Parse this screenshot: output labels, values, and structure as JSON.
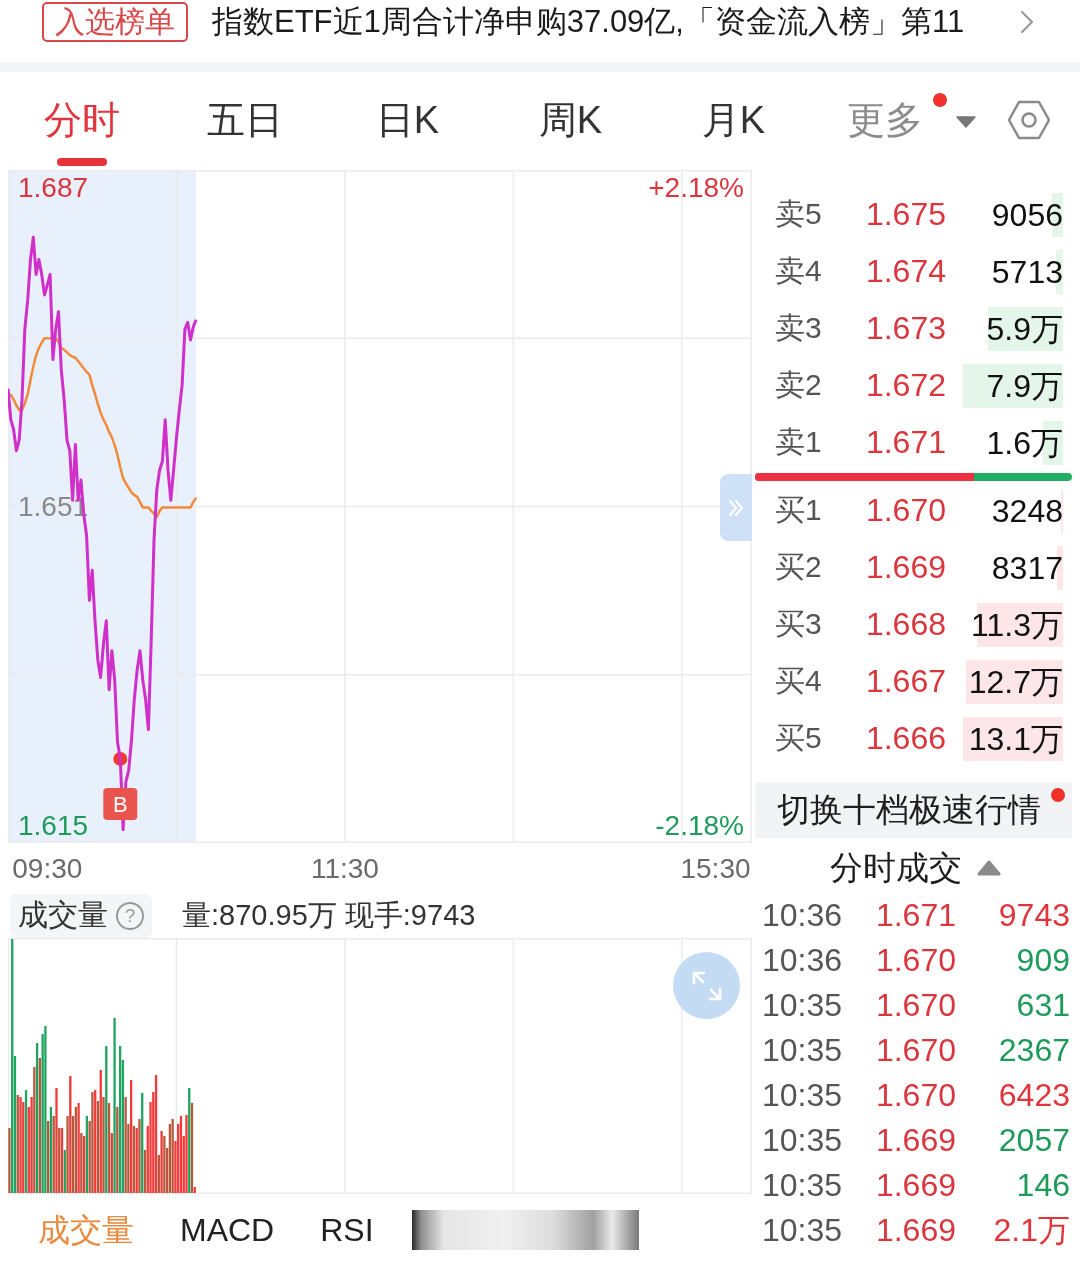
{
  "banner": {
    "badge": "入选榜单",
    "text": "指数ETF近1周合计净申购37.09亿,「资金流入榜」第11"
  },
  "chart_tabs": [
    {
      "label": "分时",
      "kind": "tab",
      "selected": true
    },
    {
      "label": "五日",
      "kind": "tab",
      "selected": false
    },
    {
      "label": "日K",
      "kind": "tab",
      "selected": false
    },
    {
      "label": "周K",
      "kind": "tab",
      "selected": false
    },
    {
      "label": "月K",
      "kind": "tab",
      "selected": false
    },
    {
      "label": "更多",
      "kind": "menu",
      "selected": false,
      "dot": true
    }
  ],
  "intraday_chart": {
    "percent_labels": [
      "+2.18%",
      "-2.18%"
    ],
    "chart_data": {
      "type": "line",
      "categories": [
        null,
        null,
        null,
        null,
        null,
        null,
        null,
        null,
        null,
        null,
        null,
        null,
        null,
        null,
        "09:30",
        null,
        null,
        null,
        null,
        null,
        null,
        null,
        null,
        null,
        null,
        null,
        null,
        null,
        null,
        null,
        null,
        null,
        null,
        null,
        null,
        null,
        null,
        null,
        null,
        null,
        null,
        null,
        null,
        null,
        null,
        null,
        null,
        null,
        null,
        null,
        null,
        null,
        null,
        null,
        null,
        null,
        null,
        null,
        null,
        null,
        null,
        null,
        null,
        null,
        null,
        null,
        null,
        null,
        null,
        null,
        null,
        null,
        null,
        null,
        null,
        null,
        null,
        null,
        null,
        null,
        null,
        null,
        null,
        null,
        null,
        null,
        null,
        null,
        null,
        null,
        null,
        null,
        null,
        null,
        null,
        null,
        null,
        null,
        null,
        null,
        null,
        null,
        null,
        null,
        null,
        null,
        null,
        null,
        null,
        null,
        null,
        null,
        null,
        null,
        null,
        null,
        null,
        null,
        null,
        null,
        "11:30",
        null,
        null,
        null,
        null,
        null,
        null,
        null,
        null,
        null,
        null,
        null,
        null,
        null,
        null,
        null,
        null,
        null,
        null,
        null,
        null,
        null,
        null,
        null,
        null,
        null,
        null,
        null,
        null,
        null,
        null,
        null,
        null,
        null,
        null,
        null,
        null,
        null,
        null,
        null,
        null,
        null,
        null,
        null,
        null,
        null,
        null,
        null,
        null,
        null,
        null,
        null,
        null,
        null,
        null,
        null,
        null,
        null,
        null,
        null,
        null,
        null,
        null,
        null,
        null,
        null,
        null,
        null,
        null,
        null,
        null,
        null,
        null,
        null,
        null,
        null,
        null,
        null,
        null,
        null,
        null,
        null,
        null,
        null,
        null,
        null,
        null,
        null,
        null,
        null,
        null,
        null,
        null,
        null,
        null,
        null,
        null,
        null,
        null,
        null,
        null,
        null,
        null,
        null,
        null,
        null,
        null,
        null,
        null,
        null,
        null,
        null,
        null,
        null,
        null,
        null,
        null,
        null,
        null,
        null,
        null,
        null,
        null,
        null,
        null,
        null,
        null,
        null,
        null,
        null,
        null,
        null,
        "15:30",
        null,
        null,
        null,
        null,
        null,
        null,
        null,
        null,
        null,
        null,
        null,
        null,
        null
      ],
      "series": [
        {
          "color": "#d02fca",
          "values": [
            1.6643,
            1.6608,
            1.6597,
            1.6573,
            1.6585,
            1.663,
            1.671,
            1.6743,
            1.6789,
            1.6814,
            1.6772,
            1.6789,
            1.6772,
            1.6749,
            1.676,
            1.6772,
            1.6676,
            1.671,
            1.673,
            1.6664,
            1.663,
            1.6585,
            1.6573,
            1.6517,
            1.658,
            1.6517,
            1.654,
            1.6501,
            1.6477,
            1.6404,
            1.6438,
            1.6381,
            1.6337,
            1.6317,
            1.6355,
            1.6381,
            1.6303,
            1.6347,
            1.6314,
            1.6244,
            1.6225,
            1.6145,
            1.6199,
            1.6212,
            1.6246,
            1.6292,
            1.6325,
            1.6347,
            1.6314,
            1.6292,
            1.6258,
            1.6359,
            1.6472,
            1.6529,
            1.6551,
            1.6561,
            1.6608,
            1.6551,
            1.6517,
            1.6551,
            1.6588,
            1.6619,
            1.6647,
            1.671,
            1.6718,
            1.6698,
            1.6713,
            1.6721,
            null,
            null,
            null,
            null,
            null,
            null,
            null,
            null,
            null,
            null,
            null,
            null,
            null,
            null,
            null,
            null,
            null,
            null,
            null,
            null,
            null,
            null,
            null,
            null,
            null,
            null,
            null,
            null,
            null,
            null,
            null,
            null,
            null,
            null,
            null,
            null,
            null,
            null,
            null,
            null,
            null,
            null,
            null,
            null,
            null,
            null,
            null,
            null,
            null,
            null,
            null,
            null,
            null,
            null,
            null,
            null,
            null,
            null,
            null,
            null,
            null,
            null,
            null,
            null,
            null,
            null,
            null,
            null,
            null,
            null,
            null,
            null,
            null,
            null,
            null,
            null,
            null,
            null,
            null,
            null,
            null,
            null,
            null,
            null,
            null,
            null,
            null,
            null,
            null,
            null,
            null,
            null,
            null,
            null,
            null,
            null,
            null,
            null,
            null,
            null,
            null,
            null,
            null,
            null,
            null,
            null,
            null,
            null,
            null,
            null,
            null,
            null,
            null,
            null,
            null,
            null,
            null,
            null,
            null,
            null,
            null,
            null,
            null,
            null,
            null,
            null,
            null,
            null,
            null,
            null,
            null,
            null,
            null,
            null,
            null,
            null,
            null,
            null,
            null,
            null,
            null,
            null,
            null,
            null,
            null,
            null,
            null,
            null,
            null,
            null,
            null,
            null,
            null,
            null,
            null,
            null,
            null,
            null,
            null,
            null,
            null,
            null,
            null,
            null,
            null,
            null,
            null,
            null,
            null,
            null,
            null,
            null,
            null,
            null,
            null,
            null,
            null,
            null,
            null,
            null,
            null,
            null,
            null,
            null,
            null,
            null,
            null,
            null,
            null,
            null,
            null,
            null,
            null,
            null,
            null,
            null,
            null,
            null
          ]
        },
        {
          "color": "#f08a3c",
          "values": [
            1.6636,
            1.6636,
            1.6631,
            1.6624,
            1.6619,
            1.6619,
            1.6626,
            1.6637,
            1.6653,
            1.6668,
            1.6681,
            1.6689,
            1.6695,
            1.67,
            1.67,
            1.67,
            1.67,
            1.67,
            1.6696,
            1.6689,
            1.6687,
            1.6684,
            1.6681,
            1.6679,
            1.6678,
            1.6674,
            1.667,
            1.6666,
            1.6662,
            1.6659,
            1.6647,
            1.6637,
            1.6626,
            1.6616,
            1.6608,
            1.6602,
            1.6594,
            1.6588,
            1.6579,
            1.6568,
            1.6554,
            1.6542,
            1.6536,
            1.6531,
            1.6526,
            1.6523,
            1.6521,
            1.6515,
            1.6509,
            1.6509,
            1.6509,
            1.6505,
            1.6502,
            1.6498,
            1.6505,
            1.6509,
            1.6509,
            1.6509,
            1.6509,
            1.6509,
            1.6509,
            1.6509,
            1.6509,
            1.6509,
            1.6509,
            1.6509,
            1.6515,
            1.652,
            null,
            null,
            null,
            null,
            null,
            null,
            null,
            null,
            null,
            null,
            null,
            null,
            null,
            null,
            null,
            null,
            null,
            null,
            null,
            null,
            null,
            null,
            null,
            null,
            null,
            null,
            null,
            null,
            null,
            null,
            null,
            null,
            null,
            null,
            null,
            null,
            null,
            null,
            null,
            null,
            null,
            null,
            null,
            null,
            null,
            null,
            null,
            null,
            null,
            null,
            null,
            null,
            null,
            null,
            null,
            null,
            null,
            null,
            null,
            null,
            null,
            null,
            null,
            null,
            null,
            null,
            null,
            null,
            null,
            null,
            null,
            null,
            null,
            null,
            null,
            null,
            null,
            null,
            null,
            null,
            null,
            null,
            null,
            null,
            null,
            null,
            null,
            null,
            null,
            null,
            null,
            null,
            null,
            null,
            null,
            null,
            null,
            null,
            null,
            null,
            null,
            null,
            null,
            null,
            null,
            null,
            null,
            null,
            null,
            null,
            null,
            null,
            null,
            null,
            null,
            null,
            null,
            null,
            null,
            null,
            null,
            null,
            null,
            null,
            null,
            null,
            null,
            null,
            null,
            null,
            null,
            null,
            null,
            null,
            null,
            null,
            null,
            null,
            null,
            null,
            null,
            null,
            null,
            null,
            null,
            null,
            null,
            null,
            null,
            null,
            null,
            null,
            null,
            null,
            null,
            null,
            null,
            null,
            null,
            null,
            null,
            null,
            null,
            null,
            null,
            null,
            null,
            null,
            null,
            null,
            null,
            null,
            null,
            null,
            null,
            null,
            null,
            null,
            null,
            null,
            null,
            null,
            null,
            null,
            null,
            null,
            null,
            null,
            null,
            null,
            null,
            null,
            null,
            null,
            null,
            null,
            null,
            null
          ]
        }
      ],
      "ylim": [
        1.613,
        1.689
      ],
      "yticks": [
        {
          "value": 1.615,
          "label": "1.615"
        },
        {
          "value": 1.651,
          "label": "1.651"
        },
        {
          "value": 1.687,
          "label": "1.687"
        }
      ],
      "annotations": [
        {
          "y": 1.6225,
          "text": "B"
        }
      ]
    }
  },
  "order_book": {
    "asks": [
      {
        "label": "卖5",
        "price": "1.675",
        "volume": "9056"
      },
      {
        "label": "卖4",
        "price": "1.674",
        "volume": "5713"
      },
      {
        "label": "卖3",
        "price": "1.673",
        "volume": "5.9万"
      },
      {
        "label": "卖2",
        "price": "1.672",
        "volume": "7.9万"
      },
      {
        "label": "卖1",
        "price": "1.671",
        "volume": "1.6万"
      }
    ],
    "ratio": {
      "level": 0.69
    },
    "bids": [
      {
        "label": "买1",
        "price": "1.670",
        "volume": "3248"
      },
      {
        "label": "买2",
        "price": "1.669",
        "volume": "8317"
      },
      {
        "label": "买3",
        "price": "1.668",
        "volume": "11.3万"
      },
      {
        "label": "买4",
        "price": "1.667",
        "volume": "12.7万"
      },
      {
        "label": "买5",
        "price": "1.666",
        "volume": "13.1万"
      }
    ],
    "switch_button": {
      "label": "切换十档极速行情",
      "dot": true
    }
  },
  "volume_panel": {
    "title": "成交量",
    "help": "?",
    "summary": "量:870.95万 现手:9743"
  },
  "trades": {
    "title": "分时成交",
    "rows": [
      {
        "time": "10:36",
        "price": "1.671",
        "volume": "9743",
        "color": "#e0353b"
      },
      {
        "time": "10:36",
        "price": "1.670",
        "volume": "909",
        "color": "#1e9a5a"
      },
      {
        "time": "10:35",
        "price": "1.670",
        "volume": "631",
        "color": "#1e9a5a"
      },
      {
        "time": "10:35",
        "price": "1.670",
        "volume": "2367",
        "color": "#1e9a5a"
      },
      {
        "time": "10:35",
        "price": "1.670",
        "volume": "6423",
        "color": "#e0353b"
      },
      {
        "time": "10:35",
        "price": "1.669",
        "volume": "2057",
        "color": "#1e9a5a"
      },
      {
        "time": "10:35",
        "price": "1.669",
        "volume": "146",
        "color": "#1e9a5a"
      },
      {
        "time": "10:35",
        "price": "1.669",
        "volume": "2.1万",
        "color": "#e0353b"
      }
    ]
  },
  "indicator_tabs": [
    {
      "label": "成交量",
      "kind": "tab",
      "selected": true
    },
    {
      "label": "MACD",
      "kind": "tab",
      "selected": false
    },
    {
      "label": "RSI",
      "kind": "tab",
      "selected": false
    },
    {
      "kind": "redacted",
      "selected": false
    }
  ]
}
